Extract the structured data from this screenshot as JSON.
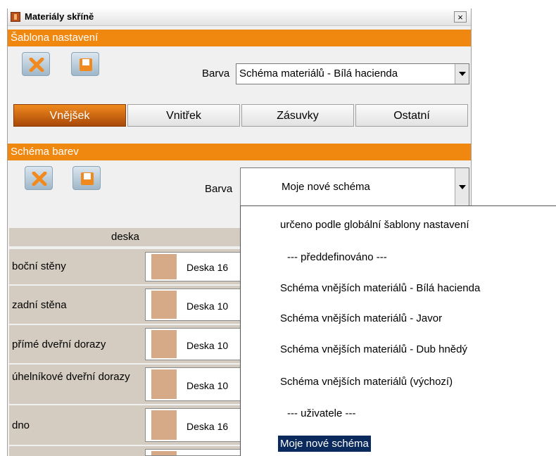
{
  "window": {
    "title": "Materiály skříně",
    "close_symbol": "×"
  },
  "template_section": {
    "header": "Šablona nastavení",
    "color_label": "Barva",
    "color_value": "Schéma materiálů - Bílá hacienda"
  },
  "tabs": [
    {
      "label": "Vnějšek",
      "active": true
    },
    {
      "label": "Vnitřek",
      "active": false
    },
    {
      "label": "Zásuvky",
      "active": false
    },
    {
      "label": "Ostatní",
      "active": false
    }
  ],
  "scheme_section": {
    "header": "Schéma barev",
    "color_label": "Barva",
    "color_value": "Moje nové schéma"
  },
  "table": {
    "header": "deska",
    "rows": [
      {
        "label": "boční stěny",
        "material": "Deska 16"
      },
      {
        "label": "zadní stěna",
        "material": "Deska 10"
      },
      {
        "label": "přímé dveřní dorazy",
        "material": "Deska 10"
      },
      {
        "label": "úhelníkové dveřní dorazy",
        "material": "Deska 10"
      },
      {
        "label": "dno",
        "material": "Deska 16"
      }
    ]
  },
  "dropdown": {
    "options": [
      "určeno podle globální šablony nastavení",
      "--- předdefinováno ---",
      "Schéma vnějších materiálů - Bílá hacienda",
      "Schéma vnějších materiálů - Javor",
      "Schéma vnějších materiálů - Dub hnědý",
      "Schéma vnějších materiálů (výchozí)",
      "--- uživatele ---",
      "Moje nové schéma"
    ],
    "selected": "Moje nové schéma"
  },
  "colors": {
    "accent": "#f0870f",
    "selection": "#0a2a5e",
    "swatch": "#d6a987"
  },
  "icons": [
    "app-icon",
    "close-icon",
    "delete-icon",
    "save-icon",
    "dropdown-arrow-icon"
  ]
}
